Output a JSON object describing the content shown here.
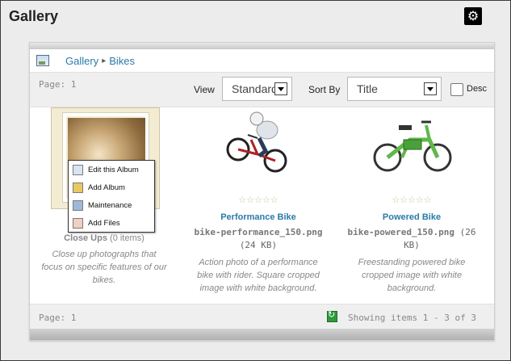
{
  "header": {
    "title": "Gallery",
    "settings_icon": "gear-icon"
  },
  "breadcrumb": {
    "icon": "gallery-icon",
    "items": [
      "Gallery",
      "Bikes"
    ],
    "separator": "▸"
  },
  "toolbar": {
    "page_label": "Page: 1",
    "view_label": "View",
    "view_value": "Standard",
    "sort_label": "Sort By",
    "sort_value": "Title",
    "desc_label": "Desc",
    "desc_checked": false
  },
  "items": [
    {
      "name": "Close Ups",
      "count": "(0 items)",
      "description": "Close up photographs that focus on specific features of our bikes.",
      "menu": [
        "Edit this Album",
        "Add Album",
        "Maintenance",
        "Add Files"
      ]
    },
    {
      "name": "Performance Bike",
      "file": "bike-performance_150.png",
      "size": "(24 KB)",
      "rating_stars": "☆☆☆☆☆",
      "description": "Action photo of a performance bike with rider. Square cropped image with white background."
    },
    {
      "name": "Powered Bike",
      "file": "bike-powered_150.png",
      "size": "(26 KB)",
      "rating_stars": "☆☆☆☆☆",
      "description": "Freestanding powered bike cropped image with white background."
    }
  ],
  "footer": {
    "page_label": "Page: 1",
    "showing": "Showing items 1 - 3 of 3"
  },
  "colors": {
    "link": "#2a7aa8",
    "muted": "#888888",
    "frame_bg": "#ececec"
  }
}
